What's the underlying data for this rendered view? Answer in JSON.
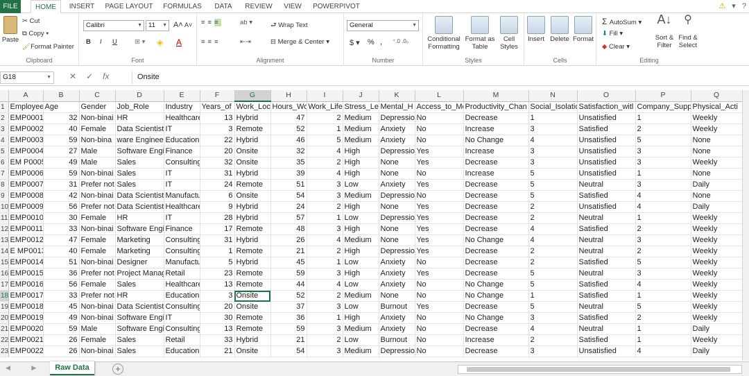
{
  "menu": {
    "tabs": [
      "FILE",
      "HOME",
      "INSERT",
      "PAGE LAYOUT",
      "FORMULAS",
      "DATA",
      "REVIEW",
      "VIEW",
      "POWERPIVOT"
    ]
  },
  "ribbon": {
    "clipboard": {
      "paste": "Paste",
      "cut": "Cut",
      "copy": "Copy",
      "format_painter": "Format Painter",
      "label": "Clipboard"
    },
    "font": {
      "name": "Calibri",
      "size": "11",
      "label": "Font",
      "bold": "B",
      "italic": "I",
      "underline": "U",
      "grow": "A",
      "shrink": "A"
    },
    "alignment": {
      "wrap": "Wrap Text",
      "merge": "Merge & Center",
      "label": "Alignment"
    },
    "number": {
      "format": "General",
      "currency": "$",
      "percent": "%",
      "comma": ",",
      "label": "Number"
    },
    "styles": {
      "conditional": "Conditional Formatting",
      "format_table": "Format as Table",
      "cell_styles": "Cell Styles",
      "label": "Styles"
    },
    "cells": {
      "insert": "Insert",
      "delete": "Delete",
      "format": "Format",
      "label": "Cells"
    },
    "editing": {
      "autosum": "AutoSum",
      "fill": "Fill",
      "clear": "Clear",
      "sort": "Sort & Filter",
      "find": "Find & Select",
      "label": "Editing"
    }
  },
  "formula_bar": {
    "name_box": "G18",
    "fx": "fx",
    "value": "Onsite"
  },
  "columns": [
    "A",
    "B",
    "C",
    "D",
    "E",
    "F",
    "G",
    "H",
    "I",
    "J",
    "K",
    "L",
    "M",
    "N",
    "O",
    "P",
    "Q"
  ],
  "rows": [
    [
      "1",
      "Employee",
      "Age",
      "Gender",
      "Job_Role",
      "Industry",
      "Years_of",
      "Work_Loc",
      "Hours_Wo",
      "Work_Life",
      "Stress_Lev",
      "Mental_H",
      "Access_to_Me",
      "Productivity_Chan",
      "Social_Isolatic",
      "Satisfaction_witl",
      "Company_Supp",
      "Physical_Acti"
    ],
    [
      "2",
      "EMP0001",
      "32",
      "Non-binai",
      "HR",
      "Healthcare",
      "13",
      "Hybrid",
      "47",
      "2",
      "Medium",
      "Depressio",
      "No",
      "Decrease",
      "1",
      "Unsatisfied",
      "1",
      "Weekly"
    ],
    [
      "3",
      "EMP0002",
      "40",
      "Female",
      "Data Scientist",
      "IT",
      "3",
      "Remote",
      "52",
      "1",
      "Medium",
      "Anxiety",
      "No",
      "Increase",
      "3",
      "Satisfied",
      "2",
      "Weekly"
    ],
    [
      "4",
      "EMP0003",
      "59",
      "Non-bina",
      "ware Engineer",
      "Education",
      "22",
      "Hybrid",
      "46",
      "5",
      "Medium",
      "Anxiety",
      "No",
      "No Change",
      "4",
      "Unsatisfied",
      "5",
      "None"
    ],
    [
      "5",
      "EMP0004",
      "27",
      "Male",
      "Software Engi",
      "Finance",
      "20",
      "Onsite",
      "32",
      "4",
      "High",
      "Depressio",
      "Yes",
      "Increase",
      "3",
      "Unsatisfied",
      "3",
      "None"
    ],
    [
      "6",
      "EM P0005",
      "49",
      "Male",
      "Sales",
      "Consulting",
      "32",
      "Onsite",
      "35",
      "2",
      "High",
      "None",
      "Yes",
      "Decrease",
      "3",
      "Unsatisfied",
      "3",
      "Weekly"
    ],
    [
      "7",
      "EMP0006",
      "59",
      "Non-binai",
      "Sales",
      "IT",
      "31",
      "Hybrid",
      "39",
      "4",
      "High",
      "None",
      "No",
      "Increase",
      "5",
      "Unsatisfied",
      "1",
      "None"
    ],
    [
      "8",
      "EMP0007",
      "31",
      "Prefer not",
      "Sales",
      "IT",
      "24",
      "Remote",
      "51",
      "3",
      "Low",
      "Anxiety",
      "Yes",
      "Decrease",
      "5",
      "Neutral",
      "3",
      "Daily"
    ],
    [
      "9",
      "EMP0008",
      "42",
      "Non-binai",
      "Data Scientist",
      "Manufactu",
      "6",
      "Onsite",
      "54",
      "3",
      "Medium",
      "Depressio",
      "No",
      "Decrease",
      "5",
      "Satisfied",
      "4",
      "None"
    ],
    [
      "10",
      "EMP0009",
      "56",
      "Prefer not",
      "Data Scientist",
      "Healthcare",
      "9",
      "Hybrid",
      "24",
      "2",
      "High",
      "None",
      "Yes",
      "Decrease",
      "2",
      "Unsatisfied",
      "4",
      "Daily"
    ],
    [
      "11",
      "EMP0010",
      "30",
      "Female",
      "HR",
      "IT",
      "28",
      "Hybrid",
      "57",
      "1",
      "Low",
      "Depressio",
      "Yes",
      "Decrease",
      "2",
      "Neutral",
      "1",
      "Weekly"
    ],
    [
      "12",
      "EMP0011",
      "33",
      "Non-binai",
      "Software Engi",
      "Finance",
      "17",
      "Remote",
      "48",
      "3",
      "High",
      "None",
      "Yes",
      "Decrease",
      "4",
      "Satisfied",
      "2",
      "Weekly"
    ],
    [
      "13",
      "EMP0012",
      "47",
      "Female",
      "Marketing",
      "Consulting",
      "31",
      "Hybrid",
      "26",
      "4",
      "Medium",
      "None",
      "Yes",
      "No Change",
      "4",
      "Neutral",
      "3",
      "Weekly"
    ],
    [
      "14",
      "E MP0013",
      "40",
      "Female",
      "Marketing",
      "Consulting",
      "1",
      "Remote",
      "21",
      "2",
      "High",
      "Depressio",
      "Yes",
      "Decrease",
      "2",
      "Neutral",
      "2",
      "Weekly"
    ],
    [
      "15",
      "EMP0014",
      "51",
      "Non-binai",
      "Designer",
      "Manufactu",
      "5",
      "Hybrid",
      "45",
      "1",
      "Low",
      "Anxiety",
      "No",
      "Decrease",
      "2",
      "Satisfied",
      "5",
      "Weekly"
    ],
    [
      "16",
      "EMP0015",
      "36",
      "Prefer not",
      "Project Manag",
      "Retail",
      "23",
      "Remote",
      "59",
      "3",
      "High",
      "Anxiety",
      "Yes",
      "Decrease",
      "5",
      "Neutral",
      "3",
      "Weekly"
    ],
    [
      "17",
      "EMP0016",
      "56",
      "Female",
      "Sales",
      "Healthcare",
      "13",
      "Remote",
      "44",
      "4",
      "Low",
      "Anxiety",
      "No",
      "No Change",
      "5",
      "Satisfied",
      "4",
      "Weekly"
    ],
    [
      "18",
      "EMP0017",
      "33",
      "Prefer not",
      "HR",
      "Education",
      "3",
      "Onsite",
      "52",
      "2",
      "Medium",
      "None",
      "No",
      "No Change",
      "1",
      "Satisfied",
      "1",
      "Weekly"
    ],
    [
      "19",
      "EMP0018",
      "45",
      "Non-binai",
      "Data Scientist",
      "Consulting",
      "20",
      "Onsite",
      "37",
      "3",
      "Low",
      "Burnout",
      "Yes",
      "Decrease",
      "5",
      "Neutral",
      "5",
      "Weekly"
    ],
    [
      "20",
      "EMP0019",
      "49",
      "Non-binai",
      "Software Engi",
      "IT",
      "30",
      "Remote",
      "36",
      "1",
      "High",
      "Anxiety",
      "No",
      "No Change",
      "3",
      "Satisfied",
      "2",
      "Weekly"
    ],
    [
      "21",
      "EMP0020",
      "59",
      "Male",
      "Software Engi",
      "Consulting",
      "13",
      "Remote",
      "59",
      "3",
      "Medium",
      "Anxiety",
      "No",
      "Decrease",
      "4",
      "Neutral",
      "1",
      "Daily"
    ],
    [
      "22",
      "EMP0021",
      "26",
      "Female",
      "Sales",
      "Retail",
      "33",
      "Hybrid",
      "21",
      "2",
      "Low",
      "Burnout",
      "No",
      "Increase",
      "2",
      "Satisfied",
      "1",
      "Weekly"
    ],
    [
      "23",
      "EMP0022",
      "26",
      "Non-binai",
      "Sales",
      "Education",
      "21",
      "Onsite",
      "54",
      "3",
      "Medium",
      "Depressio",
      "No",
      "Decrease",
      "3",
      "Unsatisfied",
      "4",
      "Daily"
    ]
  ],
  "selected_cell": "G18",
  "sheet": {
    "tab": "Raw Data",
    "add": "+"
  }
}
